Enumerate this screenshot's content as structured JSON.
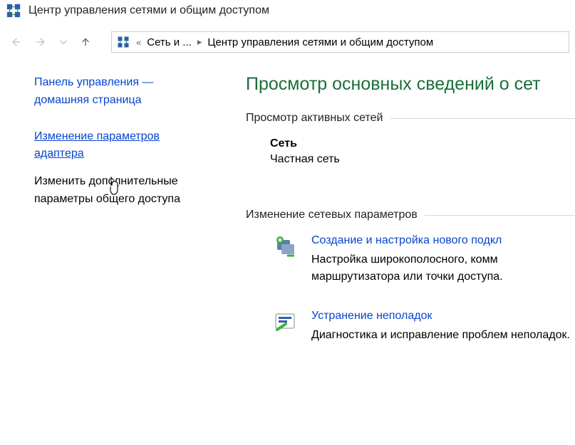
{
  "titlebar": {
    "title": "Центр управления сетями и общим доступом"
  },
  "breadcrumb": {
    "seg1": "Сеть и ...",
    "seg2": "Центр управления сетями и общим доступом"
  },
  "sidebar": {
    "home1": "Панель управления —",
    "home2": "домашняя страница",
    "adapter1": "Изменение параметров ",
    "adapter2": "адаптера",
    "advanced1": "Изменить дополнительные",
    "advanced2": "параметры общего доступа"
  },
  "main": {
    "heading": "Просмотр основных сведений о сет",
    "section_active": "Просмотр активных сетей",
    "network": {
      "name": "Сеть",
      "type": "Частная сеть"
    },
    "section_change": "Изменение сетевых параметров",
    "opt1": {
      "title": "Создание и настройка нового подкл",
      "desc": "Настройка широкополосного, комм маршрутизатора или точки доступа."
    },
    "opt2": {
      "title": "Устранение неполадок",
      "desc": "Диагностика и исправление проблем неполадок."
    }
  }
}
